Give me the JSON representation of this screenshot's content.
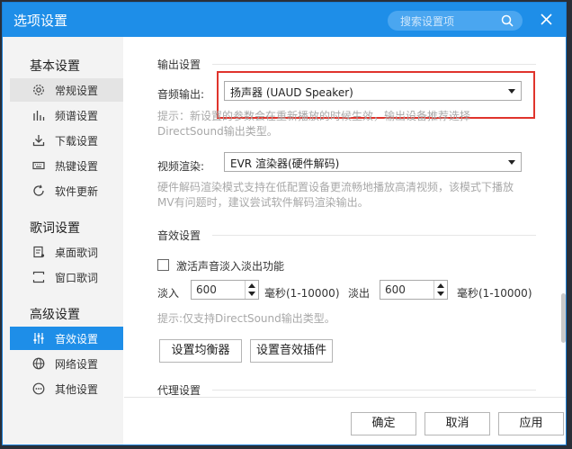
{
  "window": {
    "title": "选项设置"
  },
  "search": {
    "placeholder": "搜索设置项"
  },
  "sidebar": {
    "groups": [
      {
        "title": "基本设置",
        "items": [
          {
            "label": "常规设置"
          },
          {
            "label": "频谱设置"
          },
          {
            "label": "下载设置"
          },
          {
            "label": "热键设置"
          },
          {
            "label": "软件更新"
          }
        ]
      },
      {
        "title": "歌词设置",
        "items": [
          {
            "label": "桌面歌词"
          },
          {
            "label": "窗口歌词"
          }
        ]
      },
      {
        "title": "高级设置",
        "items": [
          {
            "label": "音效设置"
          },
          {
            "label": "网络设置"
          },
          {
            "label": "其他设置"
          }
        ]
      }
    ],
    "selected": "音效设置"
  },
  "output": {
    "section_title": "输出设置",
    "audio_label": "音频输出:",
    "audio_value": "扬声器 (UAUD Speaker)",
    "audio_hint_line1": "提示：新设置的参数会在重新播放的时候生效，输出设备推荐选择",
    "audio_hint_line2": "DirectSound输出类型。",
    "video_label": "视频渲染:",
    "video_value": "EVR 渲染器(硬件解码)",
    "video_hint_line1": "硬件解码渲染模式支持在低配置设备更流畅地播放高清视频，该模式下播放",
    "video_hint_line2": "MV有问题时，建议尝试软件解码渲染输出。"
  },
  "effects": {
    "section_title": "音效设置",
    "fade_label": "激活声音淡入淡出功能",
    "fade_checked": false,
    "fade_in_label": "淡入",
    "fade_in_value": "600",
    "fade_out_label": "淡出",
    "fade_out_value": "600",
    "unit_label": "毫秒(1-10000)",
    "hint": "提示:仅支持DirectSound输出类型。",
    "equalizer_button": "设置均衡器",
    "plugin_button": "设置音效插件"
  },
  "proxy": {
    "section_title": "代理设置"
  },
  "footer": {
    "ok": "确定",
    "cancel": "取消",
    "apply": "应用"
  },
  "colors": {
    "accent": "#1e8ee8",
    "highlight_box": "#e0342c"
  }
}
